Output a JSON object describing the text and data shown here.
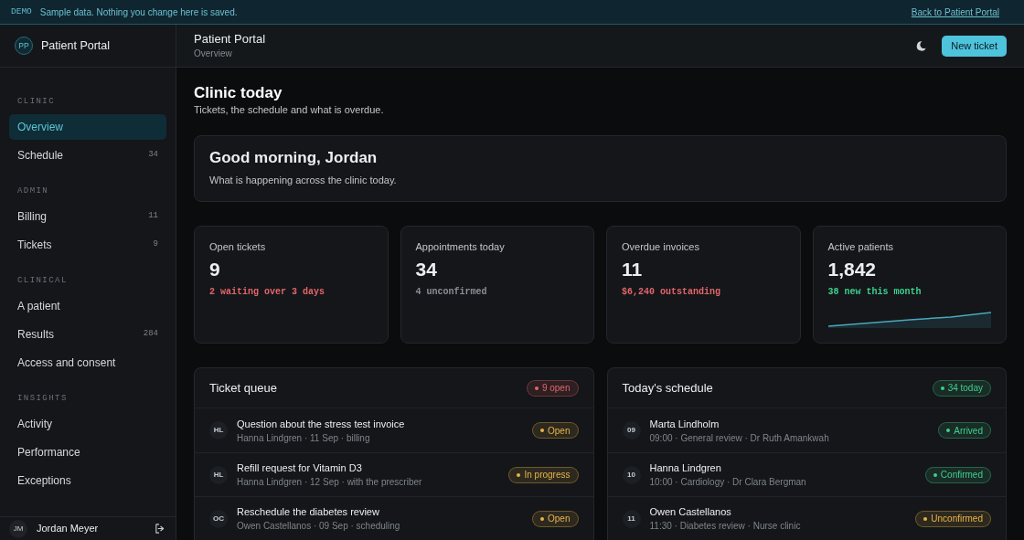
{
  "banner": {
    "tag": "DEMO",
    "message": "Sample data. Nothing you change here is saved.",
    "link": "Back to Patient Portal"
  },
  "sidebar": {
    "brand": {
      "initials": "PP",
      "name": "Patient Portal"
    },
    "sections": [
      {
        "label": "CLINIC",
        "items": [
          {
            "label": "Overview",
            "selected": true
          },
          {
            "label": "Schedule",
            "count": "34",
            "selected": false
          }
        ]
      },
      {
        "label": "ADMIN",
        "items": [
          {
            "label": "Billing",
            "count": "11",
            "selected": false
          },
          {
            "label": "Tickets",
            "count": "9",
            "selected": false
          }
        ]
      },
      {
        "label": "CLINICAL",
        "items": [
          {
            "label": "A patient",
            "selected": false
          },
          {
            "label": "Results",
            "count": "284",
            "selected": false
          },
          {
            "label": "Access and consent",
            "selected": false
          }
        ]
      },
      {
        "label": "INSIGHTS",
        "items": [
          {
            "label": "Activity",
            "selected": false
          },
          {
            "label": "Performance",
            "selected": false
          },
          {
            "label": "Exceptions",
            "selected": false
          }
        ]
      }
    ],
    "user": {
      "initials": "JM",
      "name": "Jordan Meyer"
    }
  },
  "topbar": {
    "title": "Patient Portal",
    "subtitle": "Overview",
    "button": "New ticket"
  },
  "page": {
    "title": "Clinic today",
    "subtitle": "Tickets, the schedule and what is overdue."
  },
  "greeting": {
    "title": "Good morning, Jordan",
    "text": "What is happening across the clinic today."
  },
  "stats": [
    {
      "kind": "number",
      "label": "Open tickets",
      "value": "9",
      "note": "2 waiting over 3 days",
      "color": "#e5656b"
    },
    {
      "kind": "number",
      "label": "Appointments today",
      "value": "34",
      "note": "4 unconfirmed",
      "color": "#8b9096"
    },
    {
      "kind": "number",
      "label": "Overdue invoices",
      "value": "11",
      "note": "$6,240 outstanding",
      "color": "#e5656b"
    },
    {
      "kind": "trend",
      "label": "Active patients",
      "value": "1,842",
      "note": "38 new this month",
      "color": "#3ecf8e"
    }
  ],
  "ticket_queue": {
    "title": "Ticket queue",
    "badge": {
      "text": "9 open",
      "color": "#e5656b"
    },
    "rows": [
      {
        "initials": "HL",
        "title": "Question about the stress test invoice",
        "meta": "Hanna Lindgren · 11 Sep · billing",
        "status": {
          "text": "Open",
          "color": "#e8b34a"
        }
      },
      {
        "initials": "HL",
        "title": "Refill request for Vitamin D3",
        "meta": "Hanna Lindgren · 12 Sep · with the prescriber",
        "status": {
          "text": "In progress",
          "color": "#e8b34a"
        }
      },
      {
        "initials": "OC",
        "title": "Reschedule the diabetes review",
        "meta": "Owen Castellanos · 09 Sep · scheduling",
        "status": {
          "text": "Open",
          "color": "#e8b34a"
        }
      }
    ]
  },
  "schedule": {
    "title": "Today's schedule",
    "badge": {
      "text": "34 today",
      "color": "#3ecf8e"
    },
    "rows": [
      {
        "slot": "09",
        "name": "Marta Lindholm",
        "meta": "09:00 · General review · Dr Ruth Amankwah",
        "status": {
          "text": "Arrived",
          "color": "#3ecf8e"
        }
      },
      {
        "slot": "10",
        "name": "Hanna Lindgren",
        "meta": "10:00 · Cardiology · Dr Clara Bergman",
        "status": {
          "text": "Confirmed",
          "color": "#3ecf8e"
        }
      },
      {
        "slot": "11",
        "name": "Owen Castellanos",
        "meta": "11:30 · Diabetes review · Nurse clinic",
        "status": {
          "text": "Unconfirmed",
          "color": "#e8b34a"
        }
      }
    ]
  }
}
